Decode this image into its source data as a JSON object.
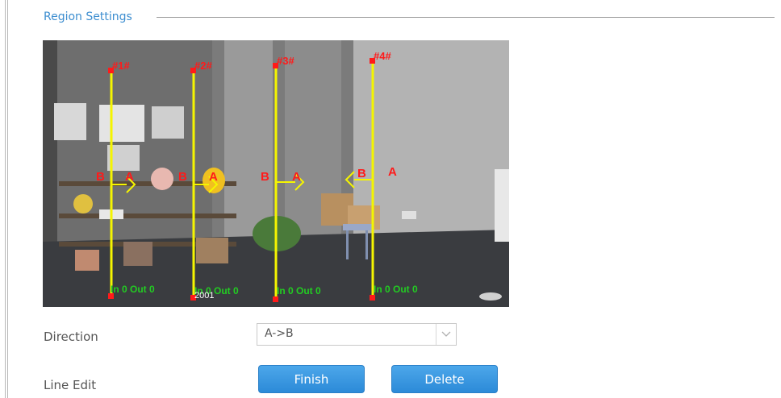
{
  "section": {
    "title": "Region Settings"
  },
  "video": {
    "overlay_timestamp": "2001",
    "lines": [
      {
        "id": "#1#",
        "side_b": "B",
        "side_a": "A",
        "arrow_direction": "right",
        "count_label": "In 0 Out 0"
      },
      {
        "id": "#2#",
        "side_b": "B",
        "side_a": "A",
        "arrow_direction": "right",
        "count_label": "In 0 Out 0"
      },
      {
        "id": "#3#",
        "side_b": "B",
        "side_a": "A",
        "arrow_direction": "right",
        "count_label": "In 0 Out 0"
      },
      {
        "id": "#4#",
        "side_b": "B",
        "side_a": "A",
        "arrow_direction": "left",
        "count_label": "In 0 Out 0"
      }
    ],
    "colors": {
      "line": "#f5f500",
      "label": "#ff1a1a",
      "count": "#22cc22"
    }
  },
  "form": {
    "direction_label": "Direction",
    "direction_value": "A->B",
    "line_edit_label": "Line Edit",
    "finish_button": "Finish",
    "delete_button": "Delete"
  },
  "theme": {
    "accent": "#3d8ed0",
    "button": "#3a99e2"
  }
}
